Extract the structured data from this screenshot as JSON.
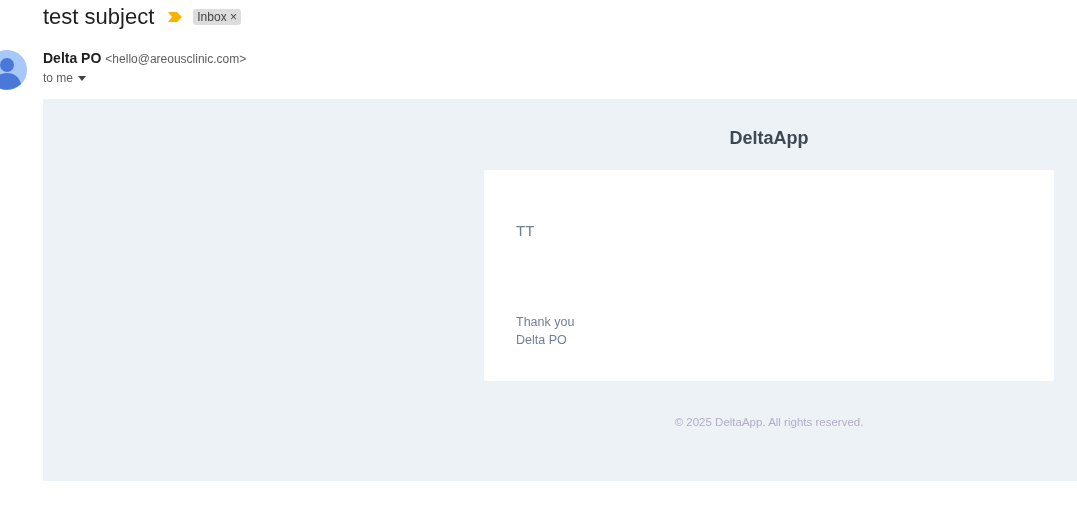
{
  "subject": "test subject",
  "important": true,
  "labels": [
    {
      "label": "Inbox",
      "remove": "×"
    }
  ],
  "sender": {
    "name": "Delta PO",
    "address": "<hello@areousclinic.com>",
    "recipient": "to me"
  },
  "message": {
    "brand": "DeltaApp",
    "body": "TT",
    "signoff": [
      "Thank you",
      "Delta PO"
    ],
    "footer": "© 2025 DeltaApp. All rights reserved."
  }
}
